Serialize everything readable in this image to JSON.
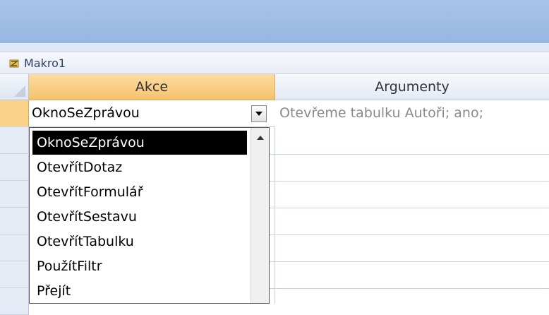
{
  "document_tab": {
    "icon": "macro-icon",
    "label": "Makro1"
  },
  "grid": {
    "columns": [
      "Akce",
      "Argumenty"
    ],
    "active_row": {
      "akce": "OknoSeZprávou",
      "argumenty": "Otevřeme tabulku Autoři; ano;"
    }
  },
  "dropdown": {
    "items": [
      "OknoSeZprávou",
      "OtevřítDotaz",
      "OtevřítFormulář",
      "OtevřítSestavu",
      "OtevřítTabulku",
      "PoužítFiltr",
      "Přejít"
    ],
    "selected_index": 0
  },
  "colors": {
    "header_active": "#f6c26d",
    "titlebar": "#a9c3e8",
    "selected_item": "#000000"
  }
}
